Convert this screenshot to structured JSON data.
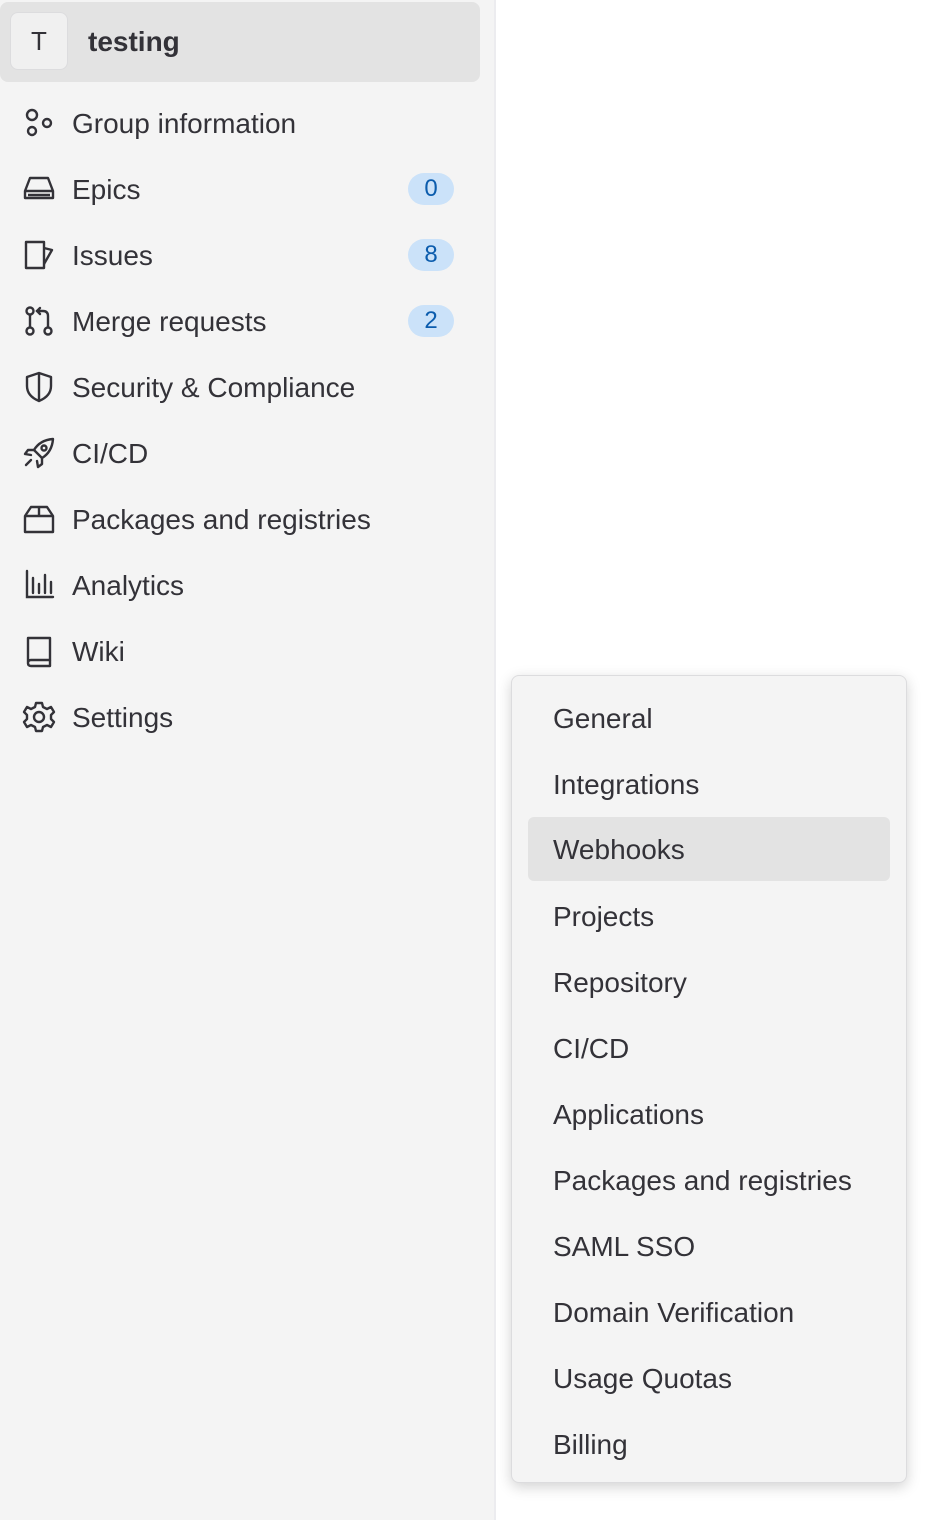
{
  "group": {
    "avatar_letter": "T",
    "name": "testing"
  },
  "nav": [
    {
      "label": "Group information",
      "icon": "group-icon"
    },
    {
      "label": "Epics",
      "icon": "epic-icon",
      "badge": "0"
    },
    {
      "label": "Issues",
      "icon": "issues-icon",
      "badge": "8"
    },
    {
      "label": "Merge requests",
      "icon": "merge-request-icon",
      "badge": "2"
    },
    {
      "label": "Security & Compliance",
      "icon": "shield-icon"
    },
    {
      "label": "CI/CD",
      "icon": "rocket-icon"
    },
    {
      "label": "Packages and registries",
      "icon": "package-icon"
    },
    {
      "label": "Analytics",
      "icon": "chart-icon"
    },
    {
      "label": "Wiki",
      "icon": "book-icon"
    },
    {
      "label": "Settings",
      "icon": "gear-icon"
    }
  ],
  "settings_flyout": {
    "items": [
      {
        "label": "General"
      },
      {
        "label": "Integrations"
      },
      {
        "label": "Webhooks",
        "active": true
      },
      {
        "label": "Projects"
      },
      {
        "label": "Repository"
      },
      {
        "label": "CI/CD"
      },
      {
        "label": "Applications"
      },
      {
        "label": "Packages and registries"
      },
      {
        "label": "SAML SSO"
      },
      {
        "label": "Domain Verification"
      },
      {
        "label": "Usage Quotas"
      },
      {
        "label": "Billing"
      }
    ]
  },
  "colors": {
    "sidebar_bg": "#f4f4f4",
    "active_bg": "#e3e3e3",
    "badge_bg": "#cbe2f9",
    "badge_text": "#0b5cad",
    "text": "#333238"
  }
}
